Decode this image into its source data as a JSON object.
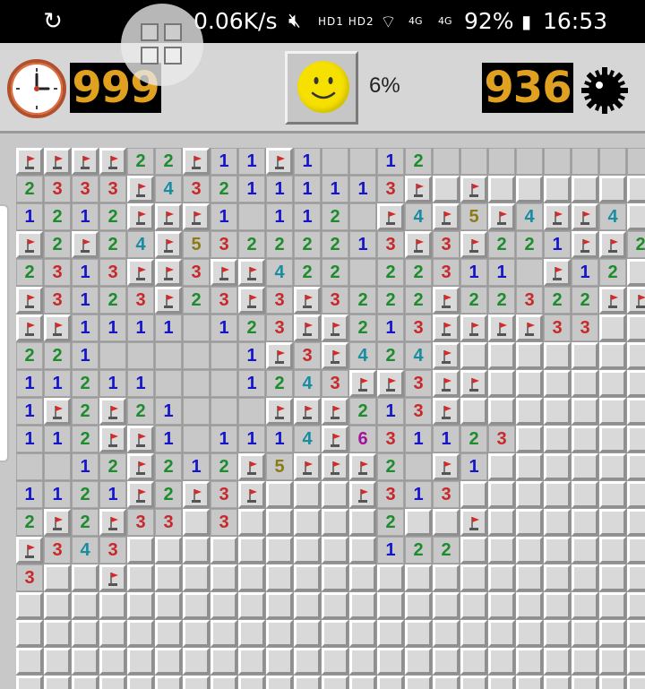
{
  "status_bar": {
    "sync_icon": "sync-icon",
    "speed": "0.06K/s",
    "mute_icon": "mute-icon",
    "hd_text": "HD1 HD2",
    "wifi_icon": "wifi-icon",
    "signal1_text": "4G",
    "signal2_text": "4G",
    "battery": "92%",
    "battery_icon": "battery-icon",
    "time": "16:53"
  },
  "header": {
    "timer": "999",
    "mines_remaining": "936",
    "progress": "6%",
    "clock_icon": "clock-icon",
    "face_icon": "smiley-face-icon",
    "settings_icon": "mine-gear-icon"
  },
  "overlay": {
    "icon": "multi-window-icon"
  },
  "colors": {
    "1": "#1414c8",
    "2": "#1c8c2c",
    "3": "#c8282a",
    "4": "#188ca0",
    "5": "#8c7a14",
    "6": "#a0149c",
    "led": "#e0a020",
    "flag": "#d42a2a"
  },
  "board": {
    "legend": "F = flag, . = unopened, 0 = opened empty, digits = adjacent mine count",
    "rows": [
      "FFFF22F11F1001200000000",
      "2333F432111113F.F......",
      "1212FFF101120F4F5F4FF4.",
      "F2F24F53222213F3F221FF2",
      "2313FF3FF4220223110F12.",
      "F3123F23F3F3222F22322FF",
      "FF11110123FF213FFFF33..",
      "221000001F3F424F.......",
      "112110001243FF3FF......",
      "1F2F21000FFF213F.......",
      "112FF101114F631123.....",
      "0012F212F5FFF20F1......",
      "1121F2F3F...F313.......",
      "2F2F33.3.....2..F......",
      "F343.........122.......",
      "3..F...................",
      ".......................",
      ".......................",
      ".......................",
      "......................."
    ]
  }
}
